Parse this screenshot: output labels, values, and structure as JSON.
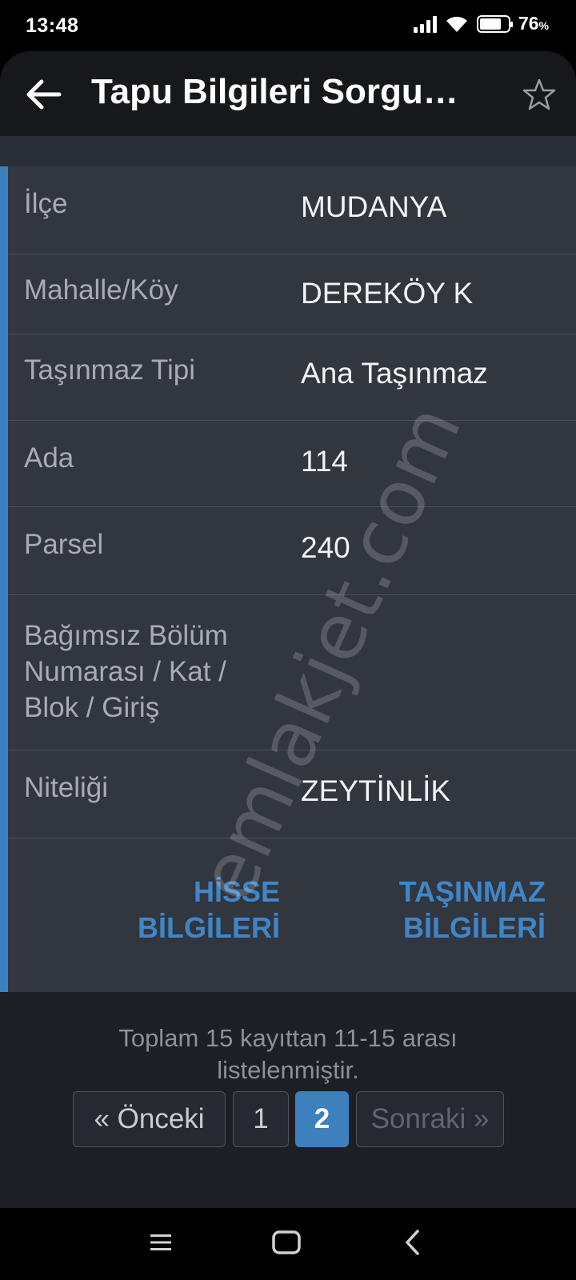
{
  "status_bar": {
    "time": "13:48",
    "battery": "76",
    "battery_unit": "%",
    "battery_level": 0.76
  },
  "app_bar": {
    "title": "Tapu Bilgileri Sorgu…",
    "back_icon": "arrow-left-icon",
    "favorite_icon": "star-outline-icon"
  },
  "record": {
    "rows": [
      {
        "label": "İlçe",
        "value": "MUDANYA"
      },
      {
        "label": "Mahalle/Köy",
        "value": "DEREKÖY K"
      },
      {
        "label": "Taşınmaz Tipi",
        "value": "Ana Taşınmaz"
      },
      {
        "label": "Ada",
        "value": "114"
      },
      {
        "label": "Parsel",
        "value": "240"
      },
      {
        "label": "Bağımsız Bölüm Numarası / Kat / Blok / Giriş",
        "value": ""
      },
      {
        "label": "Niteliği",
        "value": "ZEYTİNLİK"
      }
    ],
    "actions": {
      "share_info": "HİSSE BİLGİLERİ",
      "property_info": "TAŞINMAZ BİLGİLERİ"
    }
  },
  "pagination": {
    "summary": "Toplam 15 kayıttan 11-15 arası listelenmiştir.",
    "prev_label": "« Önceki",
    "page_1": "1",
    "page_2": "2",
    "next_label": "Sonraki »",
    "active_page": "2"
  },
  "watermark": "emlakjet.com",
  "colors": {
    "accent": "#3c80bd",
    "card_bg": "#32363f",
    "page_bg": "#1d1f24"
  }
}
